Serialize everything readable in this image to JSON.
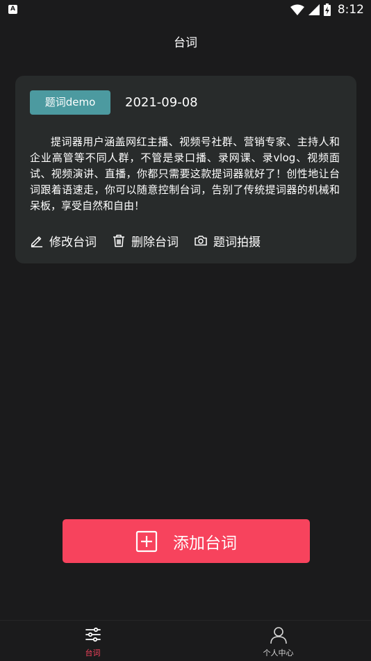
{
  "status_bar": {
    "app_badge": "A",
    "time": "8:12"
  },
  "header": {
    "title": "台词"
  },
  "script_card": {
    "tag": "题词demo",
    "date": "2021-09-08",
    "content": "提词器用户涵盖网红主播、视频号社群、营销专家、主持人和企业高管等不同人群，不管是录口播、录网课、录vlog、视频面试、视频演讲、直播，你都只需要这款提词器就好了！创性地让台词跟着语速走，你可以随意控制台词，告别了传统提词器的机械和呆板，享受自然和自由！",
    "actions": [
      {
        "label": "修改台词",
        "icon": "edit-icon"
      },
      {
        "label": "删除台词",
        "icon": "trash-icon"
      },
      {
        "label": "题词拍摄",
        "icon": "camera-icon"
      }
    ]
  },
  "add_button": {
    "label": "添加台词",
    "icon": "add-square-icon"
  },
  "bottom_nav": {
    "items": [
      {
        "label": "台词",
        "icon": "sliders-icon",
        "active": true
      },
      {
        "label": "个人中心",
        "icon": "person-icon",
        "active": false
      }
    ]
  },
  "colors": {
    "background": "#1b1b1c",
    "card": "#282b2b",
    "tag": "#4c9aa0",
    "accent": "#f7435d",
    "nav_active": "#f7435d",
    "nav_inactive": "#d8d8d8"
  }
}
